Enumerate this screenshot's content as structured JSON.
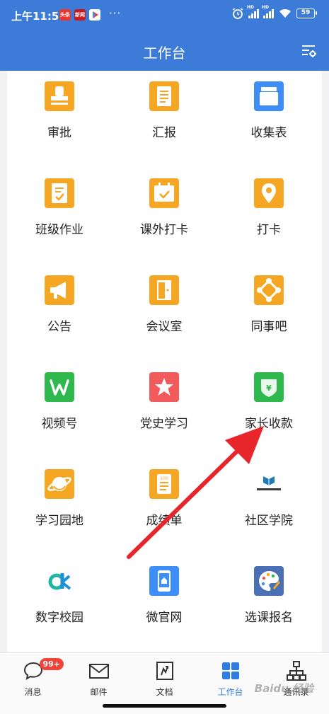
{
  "status_bar": {
    "time": "上午11:59",
    "apps": [
      {
        "icon": "toutiao-app-icon",
        "text": "头条",
        "color": "#e8372f"
      },
      {
        "icon": "news-app-icon",
        "text": "新闻",
        "color": "#c8191e"
      },
      {
        "icon": "video-app-icon",
        "text": "",
        "color": "#ffffff"
      }
    ],
    "more": "···",
    "network": "HD",
    "battery": "59"
  },
  "header": {
    "title": "工作台"
  },
  "apps": [
    {
      "label": "审批",
      "icon": "stamp-icon",
      "color": "#f5a623"
    },
    {
      "label": "汇报",
      "icon": "report-icon",
      "color": "#f5a623"
    },
    {
      "label": "收集表",
      "icon": "collection-form-icon",
      "color": "#3e8ef7"
    },
    {
      "label": "班级作业",
      "icon": "homework-icon",
      "color": "#f5a623"
    },
    {
      "label": "课外打卡",
      "icon": "calendar-check-icon",
      "color": "#f5a623"
    },
    {
      "label": "打卡",
      "icon": "location-pin-icon",
      "color": "#f5a623"
    },
    {
      "label": "公告",
      "icon": "megaphone-icon",
      "color": "#f5a623"
    },
    {
      "label": "会议室",
      "icon": "door-icon",
      "color": "#f5a623"
    },
    {
      "label": "同事吧",
      "icon": "network-icon",
      "color": "#f5a623"
    },
    {
      "label": "视频号",
      "icon": "video-channel-icon",
      "color": "#2eb84d"
    },
    {
      "label": "党史学习",
      "icon": "star-icon",
      "color": "#f25b5b"
    },
    {
      "label": "家长收款",
      "icon": "yuan-shield-icon",
      "color": "#2eb84d"
    },
    {
      "label": "学习园地",
      "icon": "planet-icon",
      "color": "#f5a623"
    },
    {
      "label": "成绩单",
      "icon": "score-sheet-icon",
      "color": "#f5a623"
    },
    {
      "label": "社区学院",
      "icon": "community-college-logo-icon",
      "color": "#ffffff"
    },
    {
      "label": "数字校园",
      "icon": "digital-campus-logo-icon",
      "color": "#ffffff"
    },
    {
      "label": "微官网",
      "icon": "mobile-home-icon",
      "color": "#3e8ef7"
    },
    {
      "label": "选课报名",
      "icon": "palette-icon",
      "color": "#4a6fb5"
    }
  ],
  "tabs": [
    {
      "label": "消息",
      "icon": "message-bubble-icon",
      "badge": "99+"
    },
    {
      "label": "邮件",
      "icon": "mail-icon"
    },
    {
      "label": "文档",
      "icon": "document-icon"
    },
    {
      "label": "工作台",
      "icon": "workbench-grid-icon",
      "active": true
    },
    {
      "label": "通讯录",
      "icon": "org-chart-icon"
    }
  ],
  "watermark": "Baidu 经验"
}
